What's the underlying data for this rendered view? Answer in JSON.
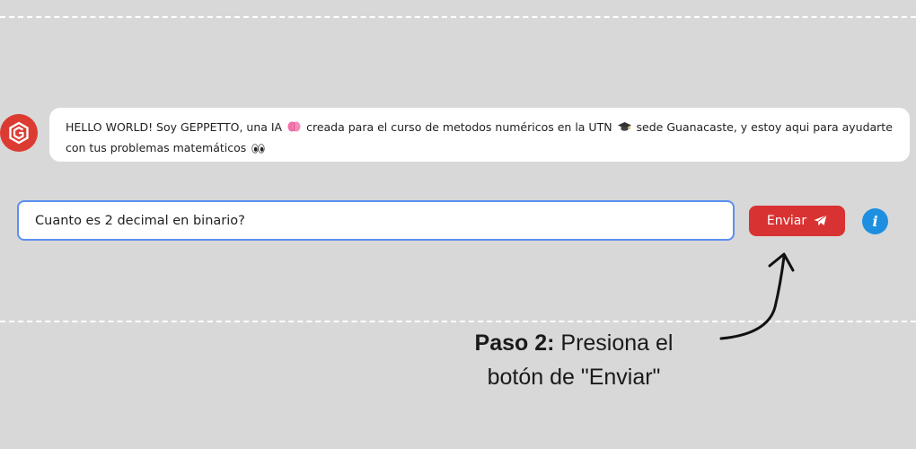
{
  "message": {
    "part1": "HELLO WORLD! Soy GEPPETTO, una IA",
    "part2": "creada para el curso de metodos numéricos en la UTN",
    "part3": "sede Guanacaste, y estoy aqui para ayudarte con tus problemas matemáticos",
    "icons": [
      "brain-icon",
      "graduation-cap-icon",
      "eyes-icon"
    ]
  },
  "chat": {
    "input_value": "Cuanto es 2 decimal en binario?",
    "send_label": "Enviar",
    "info_label": "i"
  },
  "annotation": {
    "step_label": "Paso 2:",
    "step_text": "Presiona el botón de \"Enviar\""
  },
  "colors": {
    "background": "#d8d8d8",
    "send_button": "#d93232",
    "info_button": "#1e8fe0",
    "input_border": "#5b8ff0",
    "avatar": "#dc3b32"
  }
}
